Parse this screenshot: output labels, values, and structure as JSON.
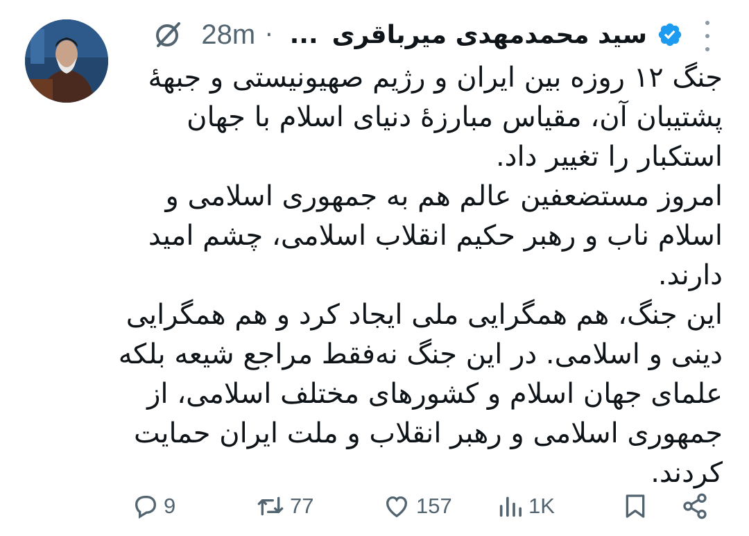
{
  "author": {
    "display_name": "سید محمدمهدی میرباقری",
    "truncation": "...",
    "verified": true,
    "separator": "·",
    "timestamp": "28m"
  },
  "tweet": {
    "paragraphs": [
      "جنگ ۱۲ روزه بین ایران و رژیم صهیونیستی و جبههٔ پشتیبان آن، مقیاس مبارزهٔ دنیای اسلام با جهان استکبار را تغییر داد.",
      "امروز مستضعفین عالم هم به جمهوری اسلامی و اسلام ناب و رهبر حکیم انقلاب اسلامی، چشم امید دارند.",
      "این جنگ، هم همگرایی ملی ایجاد کرد و هم همگرایی دینی و اسلامی. در این جنگ نه‌فقط مراجع شیعه بلکه علمای جهان اسلام و کشورهای مختلف اسلامی، از جمهوری اسلامی و رهبر انقلاب و ملت ایران حمایت کردند."
    ]
  },
  "actions": {
    "replies": "9",
    "reposts": "77",
    "likes": "157",
    "views": "1K"
  },
  "icons": {
    "grok": "grok-icon",
    "more": "more-icon",
    "verified": "verified-badge-icon",
    "reply": "reply-icon",
    "repost": "repost-icon",
    "like": "heart-icon",
    "views": "views-icon",
    "bookmark": "bookmark-icon",
    "share": "share-icon"
  },
  "colors": {
    "verified_blue": "#1d9bf0",
    "text_primary": "#0f1419",
    "text_secondary": "#536471"
  }
}
